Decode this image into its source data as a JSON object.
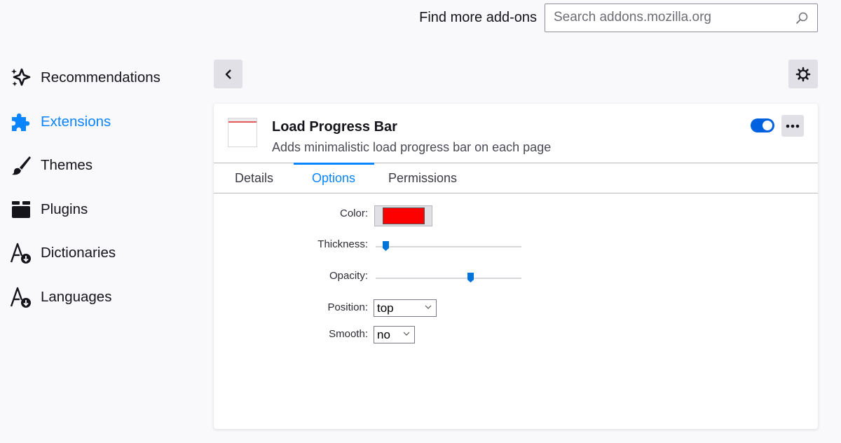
{
  "header": {
    "find_more_label": "Find more add-ons",
    "search_placeholder": "Search addons.mozilla.org"
  },
  "sidebar": {
    "items": [
      {
        "label": "Recommendations",
        "icon": "sparkles-icon",
        "active": false
      },
      {
        "label": "Extensions",
        "icon": "puzzle-icon",
        "active": true
      },
      {
        "label": "Themes",
        "icon": "brush-icon",
        "active": false
      },
      {
        "label": "Plugins",
        "icon": "plugin-icon",
        "active": false
      },
      {
        "label": "Dictionaries",
        "icon": "dictionary-icon",
        "active": false
      },
      {
        "label": "Languages",
        "icon": "language-icon",
        "active": false
      }
    ]
  },
  "addon": {
    "name": "Load Progress Bar",
    "description": "Adds minimalistic load progress bar on each page",
    "enabled": true
  },
  "tabs": [
    {
      "label": "Details",
      "active": false
    },
    {
      "label": "Options",
      "active": true
    },
    {
      "label": "Permissions",
      "active": false
    }
  ],
  "options": {
    "color_label": "Color:",
    "color_value": "#ff0000",
    "thickness_label": "Thickness:",
    "thickness_value": 0.05,
    "opacity_label": "Opacity:",
    "opacity_value": 0.66,
    "position_label": "Position:",
    "position_value": "top",
    "smooth_label": "Smooth:",
    "smooth_value": "no"
  },
  "colors": {
    "accent": "#0a84ff",
    "toggle": "#0061e0",
    "slider_thumb": "#0074d9"
  }
}
